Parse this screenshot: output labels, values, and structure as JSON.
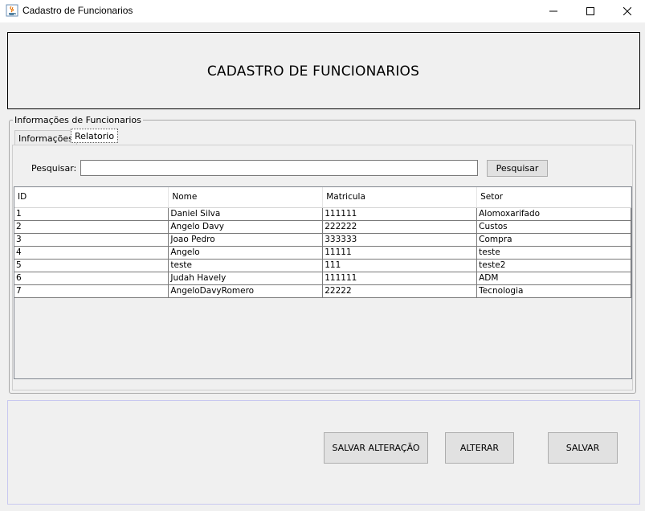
{
  "window": {
    "title": "Cadastro de Funcionarios",
    "minimize_icon": "minimize-icon",
    "maximize_icon": "maximize-icon",
    "close_icon": "close-icon"
  },
  "header": {
    "title": "CADASTRO DE FUNCIONARIOS"
  },
  "group": {
    "title": "Informações de Funcionarios",
    "tabs": [
      {
        "label": "Informações"
      },
      {
        "label": "Relatorio"
      }
    ]
  },
  "search": {
    "label": "Pesquisar:",
    "value": "",
    "button_label": "Pesquisar"
  },
  "table": {
    "columns": [
      "ID",
      "Nome",
      "Matricula",
      "Setor"
    ],
    "rows": [
      [
        "1",
        "Daniel Silva",
        "111111",
        "Alomoxarifado"
      ],
      [
        "2",
        "Angelo Davy",
        "222222",
        "Custos"
      ],
      [
        "3",
        "Joao Pedro",
        "333333",
        "Compra"
      ],
      [
        "4",
        "Angelo",
        "11111",
        "teste"
      ],
      [
        "5",
        "teste",
        "111",
        "teste2"
      ],
      [
        "6",
        "Judah Havely",
        "111111",
        "ADM"
      ],
      [
        "7",
        "AngeloDavyRomero",
        "22222",
        "Tecnologia"
      ]
    ]
  },
  "actions": {
    "save_changes_label": "SALVAR ALTERAÇÃO",
    "edit_label": "ALTERAR",
    "save_label": "SALVAR"
  }
}
